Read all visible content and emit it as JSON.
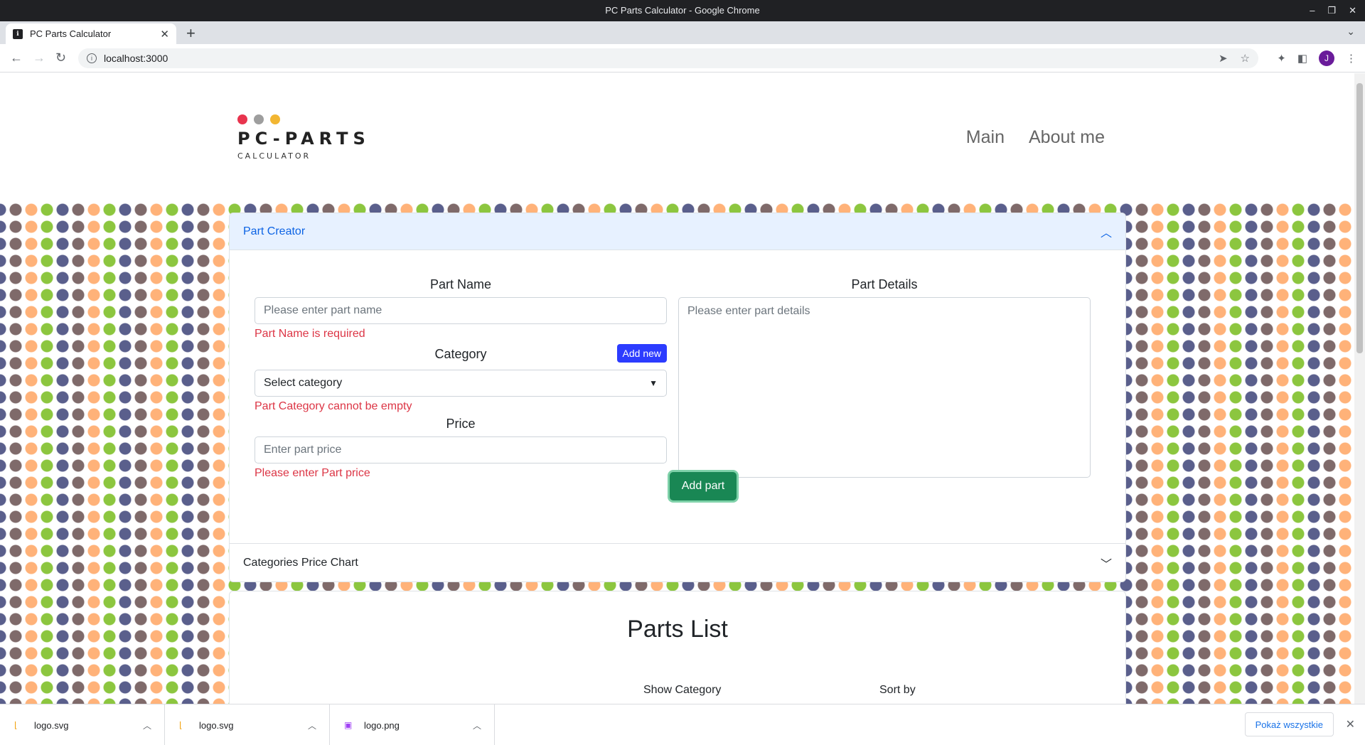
{
  "window": {
    "title": "PC Parts Calculator - Google Chrome"
  },
  "tab": {
    "title": "PC Parts Calculator"
  },
  "address": {
    "url": "localhost:3000"
  },
  "profile": {
    "initial": "J"
  },
  "logo": {
    "name": "PC-PARTS",
    "sub": "CALCULATOR",
    "dot_colors": [
      "#e8344e",
      "#9e9e9e",
      "#f2b632"
    ]
  },
  "nav": {
    "main": "Main",
    "about": "About me"
  },
  "part_creator": {
    "header": "Part Creator",
    "name_label": "Part Name",
    "name_placeholder": "Please enter part name",
    "name_error": "Part Name is required",
    "category_label": "Category",
    "add_new": "Add new",
    "category_value": "Select category",
    "category_error": "Part Category cannot be empty",
    "price_label": "Price",
    "price_placeholder": "Enter part price",
    "price_error": "Please enter Part price",
    "details_label": "Part Details",
    "details_placeholder": "Please enter part details",
    "submit": "Add part"
  },
  "chart_section": {
    "header": "Categories Price Chart"
  },
  "parts_list": {
    "title": "Parts List",
    "show_category": "Show Category",
    "sort_by": "Sort by"
  },
  "downloads": {
    "items": [
      {
        "name": "logo.svg",
        "icon": "svg-file-icon"
      },
      {
        "name": "logo.svg",
        "icon": "svg-file-icon"
      },
      {
        "name": "logo.png",
        "icon": "image-file-icon"
      }
    ],
    "show_all": "Pokaż wszystkie"
  },
  "colors": {
    "accent_blue": "#0c63e4",
    "error": "#dc3545",
    "success": "#198754",
    "add_new": "#2c3cff"
  }
}
